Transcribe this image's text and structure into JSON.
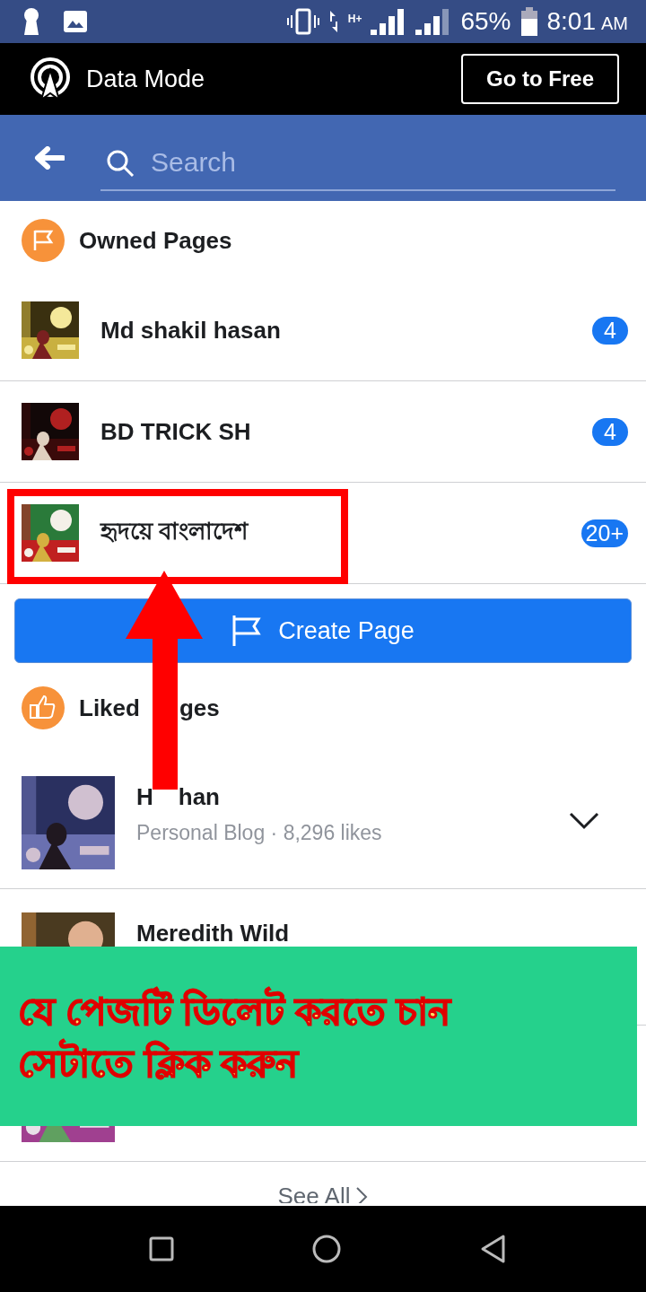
{
  "status_bar": {
    "battery": "65%",
    "time": "8:01",
    "am_pm": "AM",
    "network": "H+"
  },
  "data_mode": {
    "label": "Data Mode",
    "button": "Go to Free"
  },
  "search": {
    "placeholder": "Search"
  },
  "owned_pages": {
    "title": "Owned Pages",
    "pages": [
      {
        "name": "Md shakil hasan",
        "badge": "4",
        "highlighted": false
      },
      {
        "name": "BD TRICK SH",
        "badge": "4",
        "highlighted": false
      },
      {
        "name": "হৃদয়ে বাংলাদেশ",
        "badge": "20+",
        "highlighted": true
      }
    ],
    "create_button": "Create Page"
  },
  "liked_pages": {
    "title_parts": [
      "Liked",
      "ges"
    ],
    "pages": [
      {
        "kind": "page",
        "name_parts": [
          "H",
          "han"
        ],
        "subtitle": "Personal Blog · 8,296 likes",
        "menu": true
      },
      {
        "kind": "page",
        "name_parts": [
          "Meredith Wild"
        ],
        "menu": false
      },
      {
        "kind": "picture"
      }
    ],
    "see_all": "See All"
  },
  "annotation": {
    "lines": [
      "যে পেজটি ডিলেট করতে চান",
      "সেটাতে ক্লিক করুন"
    ]
  }
}
